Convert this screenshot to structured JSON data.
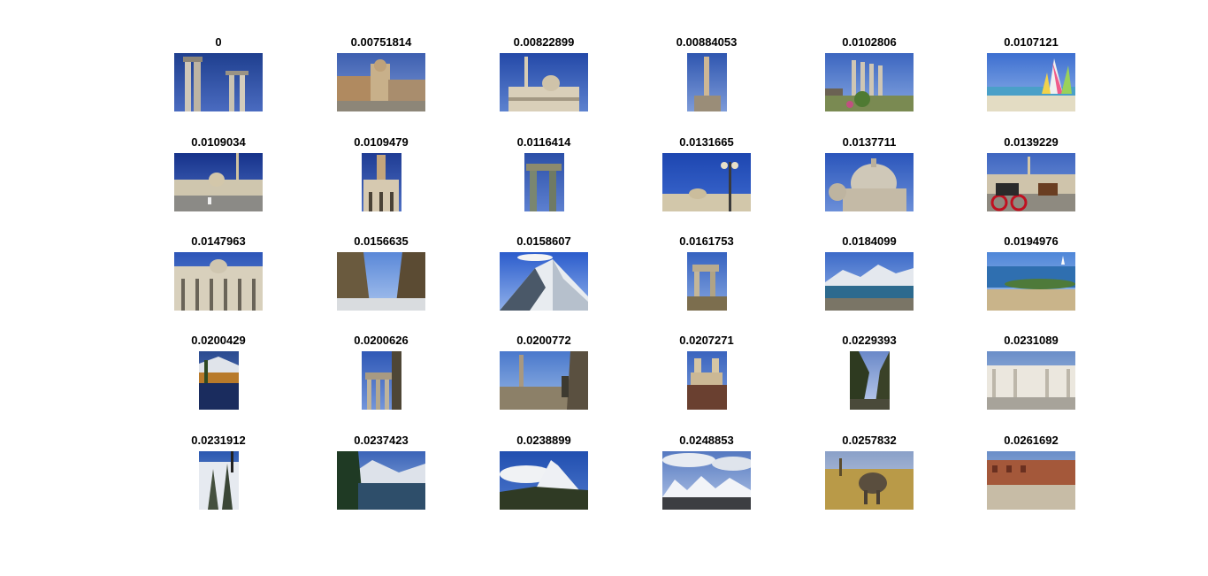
{
  "figure": {
    "cells": [
      {
        "title": "0",
        "scene": "ruins-columns",
        "w": "wide"
      },
      {
        "title": "0.00751814",
        "scene": "piazza-city",
        "w": "wide"
      },
      {
        "title": "0.00822899",
        "scene": "basilica-obelisk",
        "w": "wide"
      },
      {
        "title": "0.00884053",
        "scene": "obelisk-tall",
        "w": "narrow"
      },
      {
        "title": "0.0102806",
        "scene": "forum-columns",
        "w": "wide"
      },
      {
        "title": "0.0107121",
        "scene": "beach-sails",
        "w": "wide"
      },
      {
        "title": "0.0109034",
        "scene": "square-obelisk",
        "w": "wide"
      },
      {
        "title": "0.0109479",
        "scene": "church-tower",
        "w": "narrow"
      },
      {
        "title": "0.0116414",
        "scene": "temple-columns",
        "w": "narrow"
      },
      {
        "title": "0.0131665",
        "scene": "lamp-sky",
        "w": "wide"
      },
      {
        "title": "0.0137711",
        "scene": "dome",
        "w": "wide"
      },
      {
        "title": "0.0139229",
        "scene": "carriage",
        "w": "wide"
      },
      {
        "title": "0.0147963",
        "scene": "facade",
        "w": "wide"
      },
      {
        "title": "0.0156635",
        "scene": "gorge",
        "w": "wide"
      },
      {
        "title": "0.0158607",
        "scene": "snow-peak",
        "w": "wide"
      },
      {
        "title": "0.0161753",
        "scene": "ruin-narrow",
        "w": "narrow"
      },
      {
        "title": "0.0184099",
        "scene": "lake-mountains",
        "w": "wide"
      },
      {
        "title": "0.0194976",
        "scene": "coast",
        "w": "wide"
      },
      {
        "title": "0.0200429",
        "scene": "autumn-lake",
        "w": "narrow"
      },
      {
        "title": "0.0200626",
        "scene": "roman-temple",
        "w": "narrow"
      },
      {
        "title": "0.0200772",
        "scene": "pompeii",
        "w": "wide"
      },
      {
        "title": "0.0207271",
        "scene": "steps-church",
        "w": "narrow"
      },
      {
        "title": "0.0229393",
        "scene": "tree-silhouette",
        "w": "narrow"
      },
      {
        "title": "0.0231089",
        "scene": "monument",
        "w": "wide"
      },
      {
        "title": "0.0231912",
        "scene": "snow-trees",
        "w": "narrow"
      },
      {
        "title": "0.0237423",
        "scene": "alpine-lake",
        "w": "wide"
      },
      {
        "title": "0.0238899",
        "scene": "matterhorn",
        "w": "wide"
      },
      {
        "title": "0.0248853",
        "scene": "snowy-range",
        "w": "wide"
      },
      {
        "title": "0.0257832",
        "scene": "elephant",
        "w": "wide"
      },
      {
        "title": "0.0261692",
        "scene": "forum-ruins",
        "w": "wide"
      }
    ]
  }
}
